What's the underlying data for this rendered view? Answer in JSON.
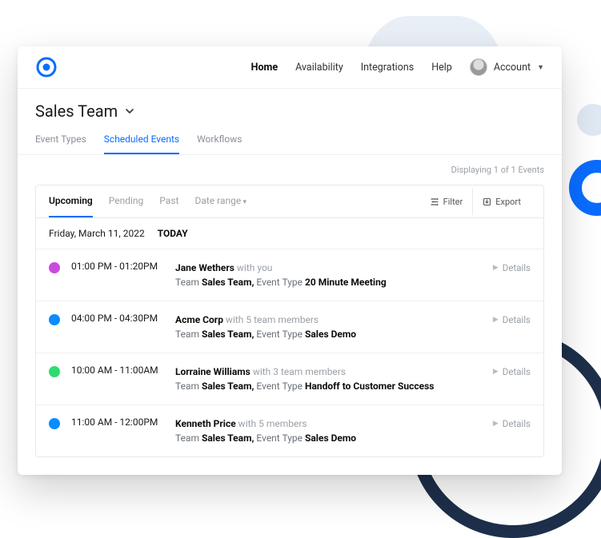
{
  "nav": {
    "home": "Home",
    "availability": "Availability",
    "integrations": "Integrations",
    "help": "Help",
    "account": "Account"
  },
  "page": {
    "title": "Sales Team"
  },
  "tabs": {
    "event_types": "Event Types",
    "scheduled_events": "Scheduled Events",
    "workflows": "Workflows"
  },
  "meta": {
    "displaying": "Displaying 1 of 1 Events"
  },
  "panel": {
    "tabs": {
      "upcoming": "Upcoming",
      "pending": "Pending",
      "past": "Past",
      "date_range": "Date range"
    },
    "actions": {
      "filter": "Filter",
      "export": "Export"
    },
    "date": "Friday, March 11, 2022",
    "today": "TODAY",
    "details_label": "Details",
    "team_label": "Team",
    "event_type_label": "Event Type"
  },
  "events": [
    {
      "color": "#c94bdc",
      "time": "01:00 PM - 01:20PM",
      "attendee": "Jane Wethers",
      "with": "with you",
      "team": "Sales Team,",
      "event_type": "20 Minute Meeting"
    },
    {
      "color": "#0a8cff",
      "time": "04:00 PM - 04:30PM",
      "attendee": "Acme Corp",
      "with": "with 5 team members",
      "team": "Sales Team,",
      "event_type": "Sales Demo"
    },
    {
      "color": "#2fdb6f",
      "time": "10:00 AM - 11:00AM",
      "attendee": "Lorraine Williams",
      "with": "with 3 team members",
      "team": "Sales Team,",
      "event_type": "Handoff to Customer Success"
    },
    {
      "color": "#0a8cff",
      "time": "11:00 AM - 12:00PM",
      "attendee": "Kenneth Price",
      "with": "with 5 members",
      "team": "Sales Team,",
      "event_type": "Sales Demo"
    }
  ]
}
